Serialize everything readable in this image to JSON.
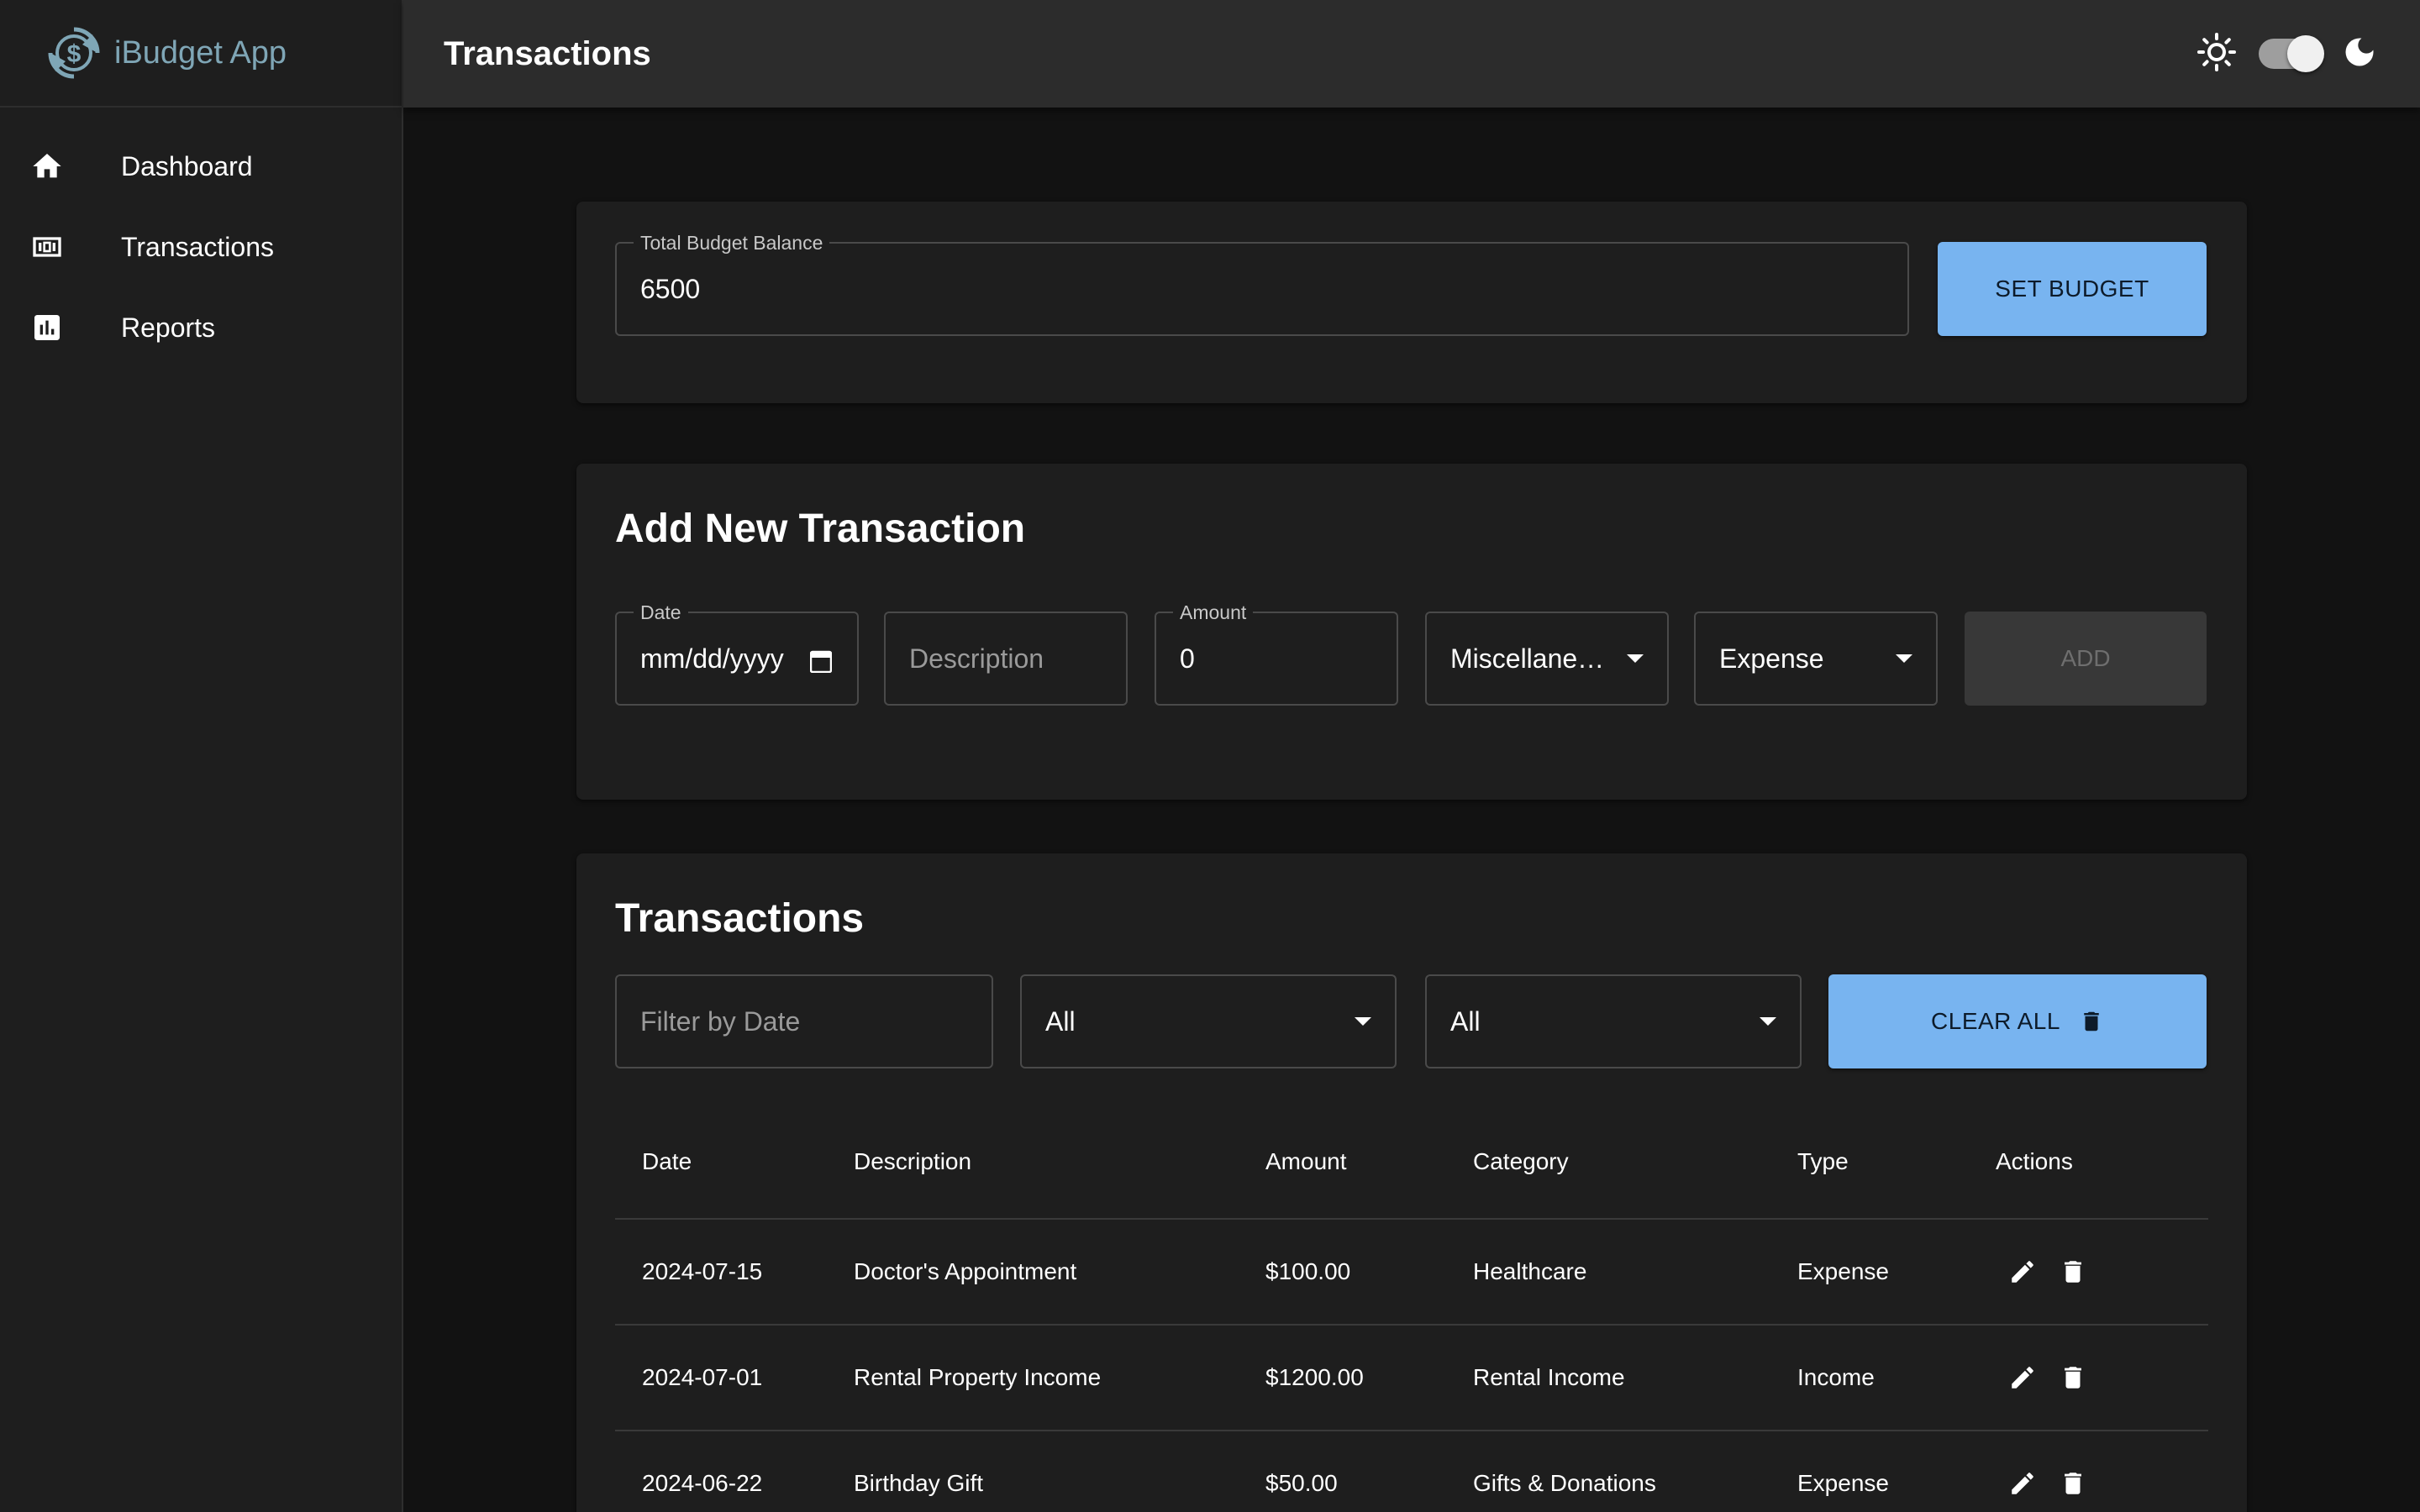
{
  "app": {
    "name": "iBudget App"
  },
  "sidebar": {
    "items": [
      {
        "label": "Dashboard",
        "icon": "home-icon"
      },
      {
        "label": "Transactions",
        "icon": "transactions-icon"
      },
      {
        "label": "Reports",
        "icon": "reports-icon"
      }
    ]
  },
  "header": {
    "title": "Transactions",
    "theme_mode": "dark"
  },
  "budget": {
    "label": "Total Budget Balance",
    "value": "6500",
    "button": "SET BUDGET"
  },
  "add_form": {
    "heading": "Add New Transaction",
    "date_label": "Date",
    "date_placeholder": "mm/dd/yyyy",
    "description_placeholder": "Description",
    "amount_label": "Amount",
    "amount_value": "0",
    "category_value": "Miscellane…",
    "type_value": "Expense",
    "add_button": "ADD"
  },
  "transactions": {
    "heading": "Transactions",
    "filter_date_placeholder": "Filter by Date",
    "filter_category": "All",
    "filter_type": "All",
    "clear_button": "CLEAR ALL",
    "columns": [
      "Date",
      "Description",
      "Amount",
      "Category",
      "Type",
      "Actions"
    ],
    "rows": [
      {
        "date": "2024-07-15",
        "description": "Doctor's Appointment",
        "amount": "$100.00",
        "category": "Healthcare",
        "type": "Expense"
      },
      {
        "date": "2024-07-01",
        "description": "Rental Property Income",
        "amount": "$1200.00",
        "category": "Rental Income",
        "type": "Income"
      },
      {
        "date": "2024-06-22",
        "description": "Birthday Gift",
        "amount": "$50.00",
        "category": "Gifts & Donations",
        "type": "Expense"
      }
    ]
  },
  "colors": {
    "background": "#121212",
    "surface": "#1e1e1e",
    "accent": "#78b4f0",
    "brand": "#7fa6b6"
  }
}
